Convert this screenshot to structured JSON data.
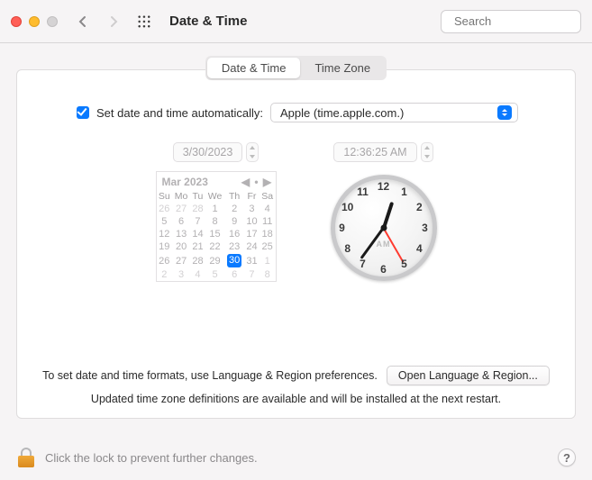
{
  "toolbar": {
    "title": "Date & Time",
    "search_placeholder": "Search"
  },
  "tabs": {
    "date_time": "Date & Time",
    "time_zone": "Time Zone"
  },
  "auto": {
    "label": "Set date and time automatically:",
    "server": "Apple (time.apple.com.)"
  },
  "date": {
    "field": "3/30/2023",
    "month_label": "Mar 2023",
    "dow": [
      "Su",
      "Mo",
      "Tu",
      "We",
      "Th",
      "Fr",
      "Sa"
    ],
    "weeks": [
      [
        {
          "d": "26",
          "dim": true
        },
        {
          "d": "27",
          "dim": true
        },
        {
          "d": "28",
          "dim": true
        },
        {
          "d": "1"
        },
        {
          "d": "2"
        },
        {
          "d": "3"
        },
        {
          "d": "4"
        }
      ],
      [
        {
          "d": "5"
        },
        {
          "d": "6"
        },
        {
          "d": "7"
        },
        {
          "d": "8"
        },
        {
          "d": "9"
        },
        {
          "d": "10"
        },
        {
          "d": "11"
        }
      ],
      [
        {
          "d": "12"
        },
        {
          "d": "13"
        },
        {
          "d": "14"
        },
        {
          "d": "15"
        },
        {
          "d": "16"
        },
        {
          "d": "17"
        },
        {
          "d": "18"
        }
      ],
      [
        {
          "d": "19"
        },
        {
          "d": "20"
        },
        {
          "d": "21"
        },
        {
          "d": "22"
        },
        {
          "d": "23"
        },
        {
          "d": "24"
        },
        {
          "d": "25"
        }
      ],
      [
        {
          "d": "26"
        },
        {
          "d": "27"
        },
        {
          "d": "28"
        },
        {
          "d": "29"
        },
        {
          "d": "30",
          "sel": true
        },
        {
          "d": "31"
        },
        {
          "d": "1",
          "dim": true
        }
      ],
      [
        {
          "d": "2",
          "dim": true
        },
        {
          "d": "3",
          "dim": true
        },
        {
          "d": "4",
          "dim": true
        },
        {
          "d": "5",
          "dim": true
        },
        {
          "d": "6",
          "dim": true
        },
        {
          "d": "7",
          "dim": true
        },
        {
          "d": "8",
          "dim": true
        }
      ]
    ]
  },
  "time": {
    "field": "12:36:25 AM",
    "ampm": "AM",
    "hour_angle": 18,
    "minute_angle": 216,
    "second_angle": 150,
    "numerals": [
      "12",
      "1",
      "2",
      "3",
      "4",
      "5",
      "6",
      "7",
      "8",
      "9",
      "10",
      "11"
    ]
  },
  "hints": {
    "format": "To set date and time formats, use Language & Region preferences.",
    "open_lr": "Open Language & Region...",
    "tz_update": "Updated time zone definitions are available and will be installed at the next restart."
  },
  "lock": {
    "text": "Click the lock to prevent further changes.",
    "help": "?"
  }
}
